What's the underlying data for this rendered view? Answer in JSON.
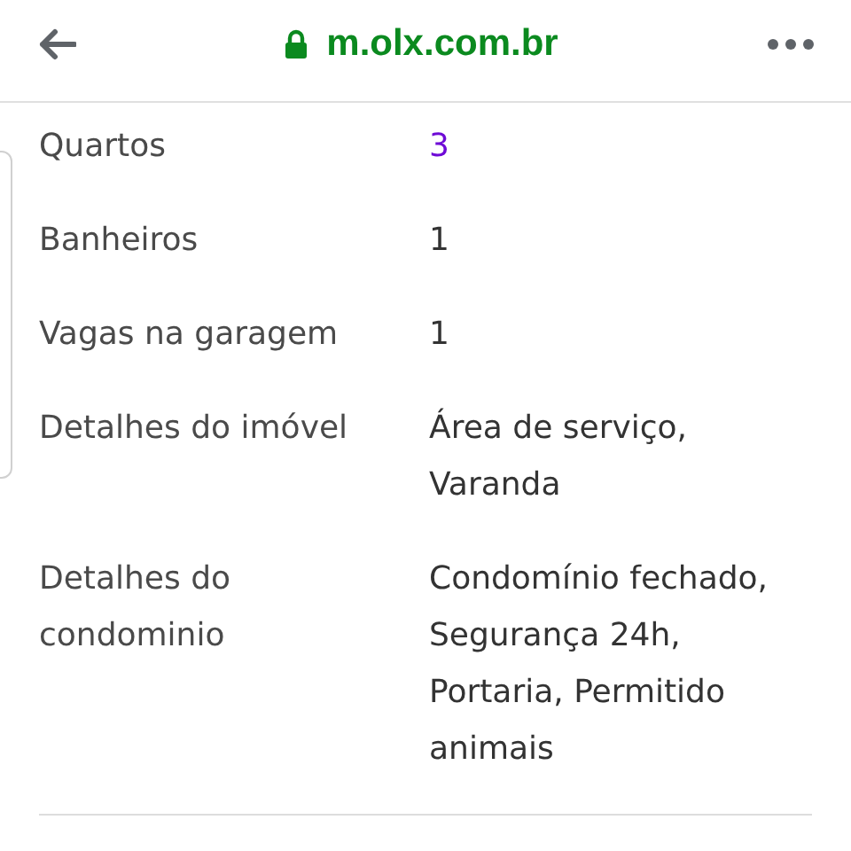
{
  "toolbar": {
    "url": "m.olx.com.br",
    "secure": true
  },
  "details": [
    {
      "label": "Quartos",
      "value": "3",
      "link": true
    },
    {
      "label": "Banheiros",
      "value": "1",
      "link": false
    },
    {
      "label": "Vagas na garagem",
      "value": "1",
      "link": false
    },
    {
      "label": "Detalhes do imóvel",
      "value": "Área de serviço, Varanda",
      "link": false
    },
    {
      "label": "Detalhes do condominio",
      "value": "Condomínio fechado, Segurança 24h, Portaria, Permitido animais",
      "link": false
    }
  ]
}
